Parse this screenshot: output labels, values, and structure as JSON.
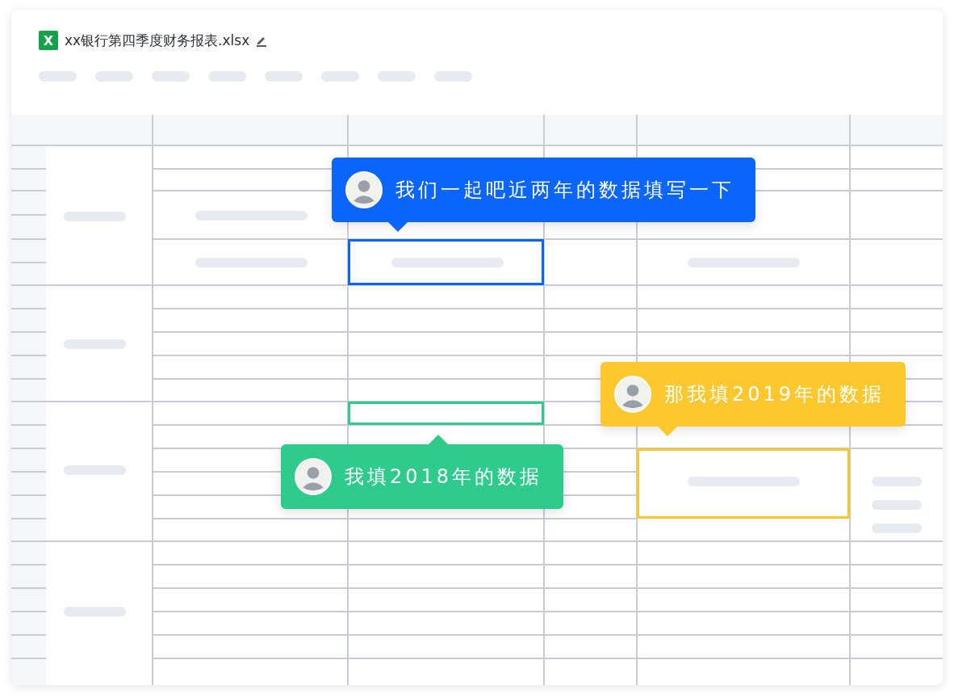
{
  "file": {
    "icon_letter": "X",
    "name": "xx银行第四季度财务报表.xlsx"
  },
  "comments": [
    {
      "text": "我们一起吧近两年的数据填写一下",
      "color": "#0b65fa"
    },
    {
      "text": "那我填2019年的数据",
      "color": "#fdc730"
    },
    {
      "text": "我填2018年的数据",
      "color": "#2ecb8d"
    }
  ]
}
